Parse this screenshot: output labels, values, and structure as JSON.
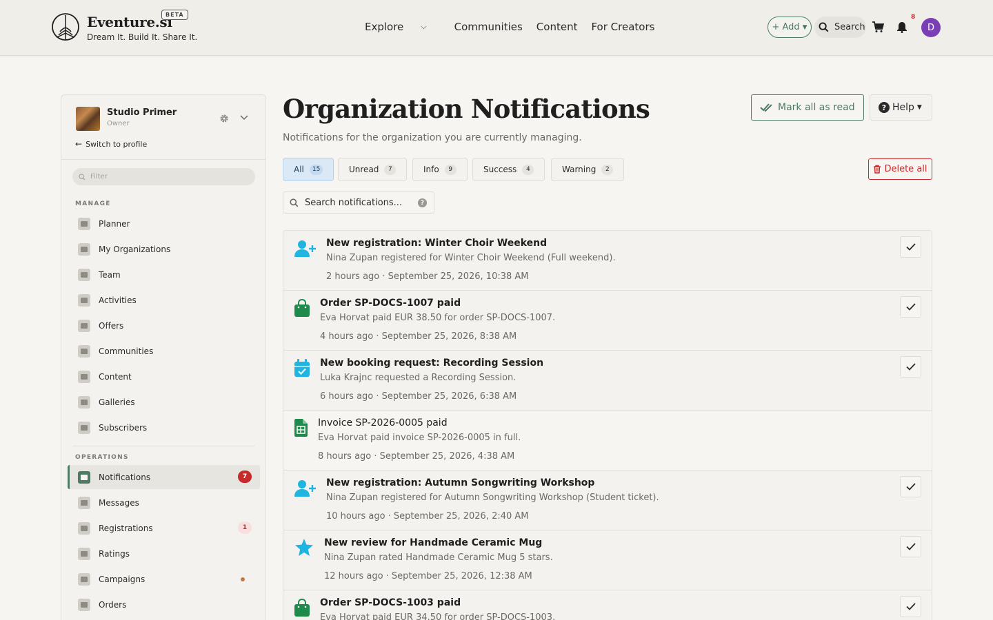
{
  "header": {
    "brand": "Eventure.si",
    "beta": "BETA",
    "tagline": "Dream It. Build It. Share It.",
    "nav": {
      "explore": "Explore",
      "communities": "Communities",
      "content": "Content",
      "creators": "For Creators"
    },
    "add_label": "+ Add",
    "search_label": "Search",
    "bell_count": "8",
    "avatar_initial": "D"
  },
  "sidebar": {
    "org_name": "Studio Primer",
    "org_role": "Owner",
    "switch_label": "Switch to profile",
    "filter_placeholder": "Filter",
    "manage_label": "MANAGE",
    "operations_label": "OPERATIONS",
    "manage_items": [
      "Planner",
      "My Organizations",
      "Team",
      "Activities",
      "Offers",
      "Communities",
      "Content",
      "Galleries",
      "Subscribers"
    ],
    "operations_items": [
      {
        "label": "Notifications",
        "badge": "7",
        "active": true
      },
      {
        "label": "Messages"
      },
      {
        "label": "Registrations",
        "badge": "1"
      },
      {
        "label": "Ratings"
      },
      {
        "label": "Campaigns",
        "dot": true
      },
      {
        "label": "Orders"
      }
    ]
  },
  "main": {
    "title": "Organization Notifications",
    "subtitle": "Notifications for the organization you are currently managing.",
    "mark_all_label": "Mark all as read",
    "help_label": "Help",
    "delete_all_label": "Delete all",
    "search_placeholder": "Search notifications...",
    "tabs": [
      {
        "label": "All",
        "count": "15"
      },
      {
        "label": "Unread",
        "count": "7"
      },
      {
        "label": "Info",
        "count": "9"
      },
      {
        "label": "Success",
        "count": "4"
      },
      {
        "label": "Warning",
        "count": "2"
      }
    ],
    "notifications": [
      {
        "icon": "user-plus-icon",
        "title": "New registration: Winter Choir Weekend",
        "body": "Nina Zupan registered for Winter Choir Weekend (Full weekend).",
        "time": "2 hours ago · September 25, 2026, 10:38 AM",
        "unread": true
      },
      {
        "icon": "shopping-bag-icon",
        "title": "Order SP-DOCS-1007 paid",
        "body": "Eva Horvat paid EUR 38.50 for order SP-DOCS-1007.",
        "time": "4 hours ago · September 25, 2026, 8:38 AM",
        "unread": true
      },
      {
        "icon": "calendar-check-icon",
        "title": "New booking request: Recording Session",
        "body": "Luka Krajnc requested a Recording Session.",
        "time": "6 hours ago · September 25, 2026, 6:38 AM",
        "unread": true
      },
      {
        "icon": "invoice-icon",
        "title": "Invoice SP-2026-0005 paid",
        "body": "Eva Horvat paid invoice SP-2026-0005 in full.",
        "time": "8 hours ago · September 25, 2026, 4:38 AM",
        "unread": false
      },
      {
        "icon": "user-plus-icon",
        "title": "New registration: Autumn Songwriting Workshop",
        "body": "Nina Zupan registered for Autumn Songwriting Workshop (Student ticket).",
        "time": "10 hours ago · September 25, 2026, 2:40 AM",
        "unread": true
      },
      {
        "icon": "star-icon",
        "title": "New review for Handmade Ceramic Mug",
        "body": "Nina Zupan rated Handmade Ceramic Mug 5 stars.",
        "time": "12 hours ago · September 25, 2026, 12:38 AM",
        "unread": true
      },
      {
        "icon": "shopping-bag-icon",
        "title": "Order SP-DOCS-1003 paid",
        "body": "Eva Horvat paid EUR 34.50 for order SP-DOCS-1003.",
        "time": "",
        "unread": true
      }
    ]
  },
  "colors": {
    "accent": "#4e7a63",
    "danger": "#c62b2b",
    "info_icon": "#1fb5e0",
    "success_icon": "#1e8a4c",
    "avatar": "#7b3fb5"
  }
}
